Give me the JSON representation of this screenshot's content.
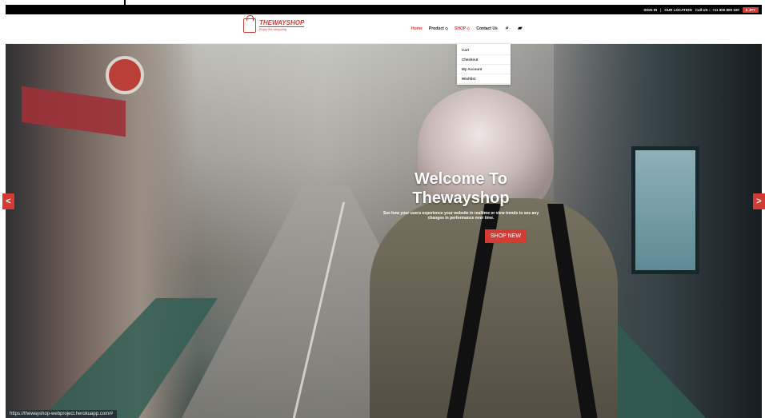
{
  "topbar": {
    "items": [
      "SIGN IN",
      "|",
      "OUR LOCATION",
      "Call US :- +11 900 800 100"
    ],
    "currency": "$ JPY"
  },
  "brand": {
    "name": "THEWAYSHOP",
    "tagline": "Enjoy the shopping"
  },
  "nav": {
    "items": [
      "Home",
      "Product ◇",
      "SHOP ◇",
      "Contact Us"
    ],
    "icons": [
      "search-icon",
      "bag-icon"
    ]
  },
  "dropdown": {
    "items": [
      "Cart",
      "Checkout",
      "My Account",
      "Wishlist"
    ]
  },
  "hero": {
    "title_line1": "Welcome To",
    "title_line2": "Thewayshop",
    "description": "See how your users experience your website in realtime or view trends to see any changes in performance over time.",
    "button": "SHOP NEW"
  },
  "arrows": {
    "left": "<",
    "right": ">"
  },
  "status_url": "https://thewayshop-webproject.herokuapp.com/#",
  "colors": {
    "accent": "#d33b33",
    "topbar": "#000000",
    "white": "#ffffff"
  }
}
